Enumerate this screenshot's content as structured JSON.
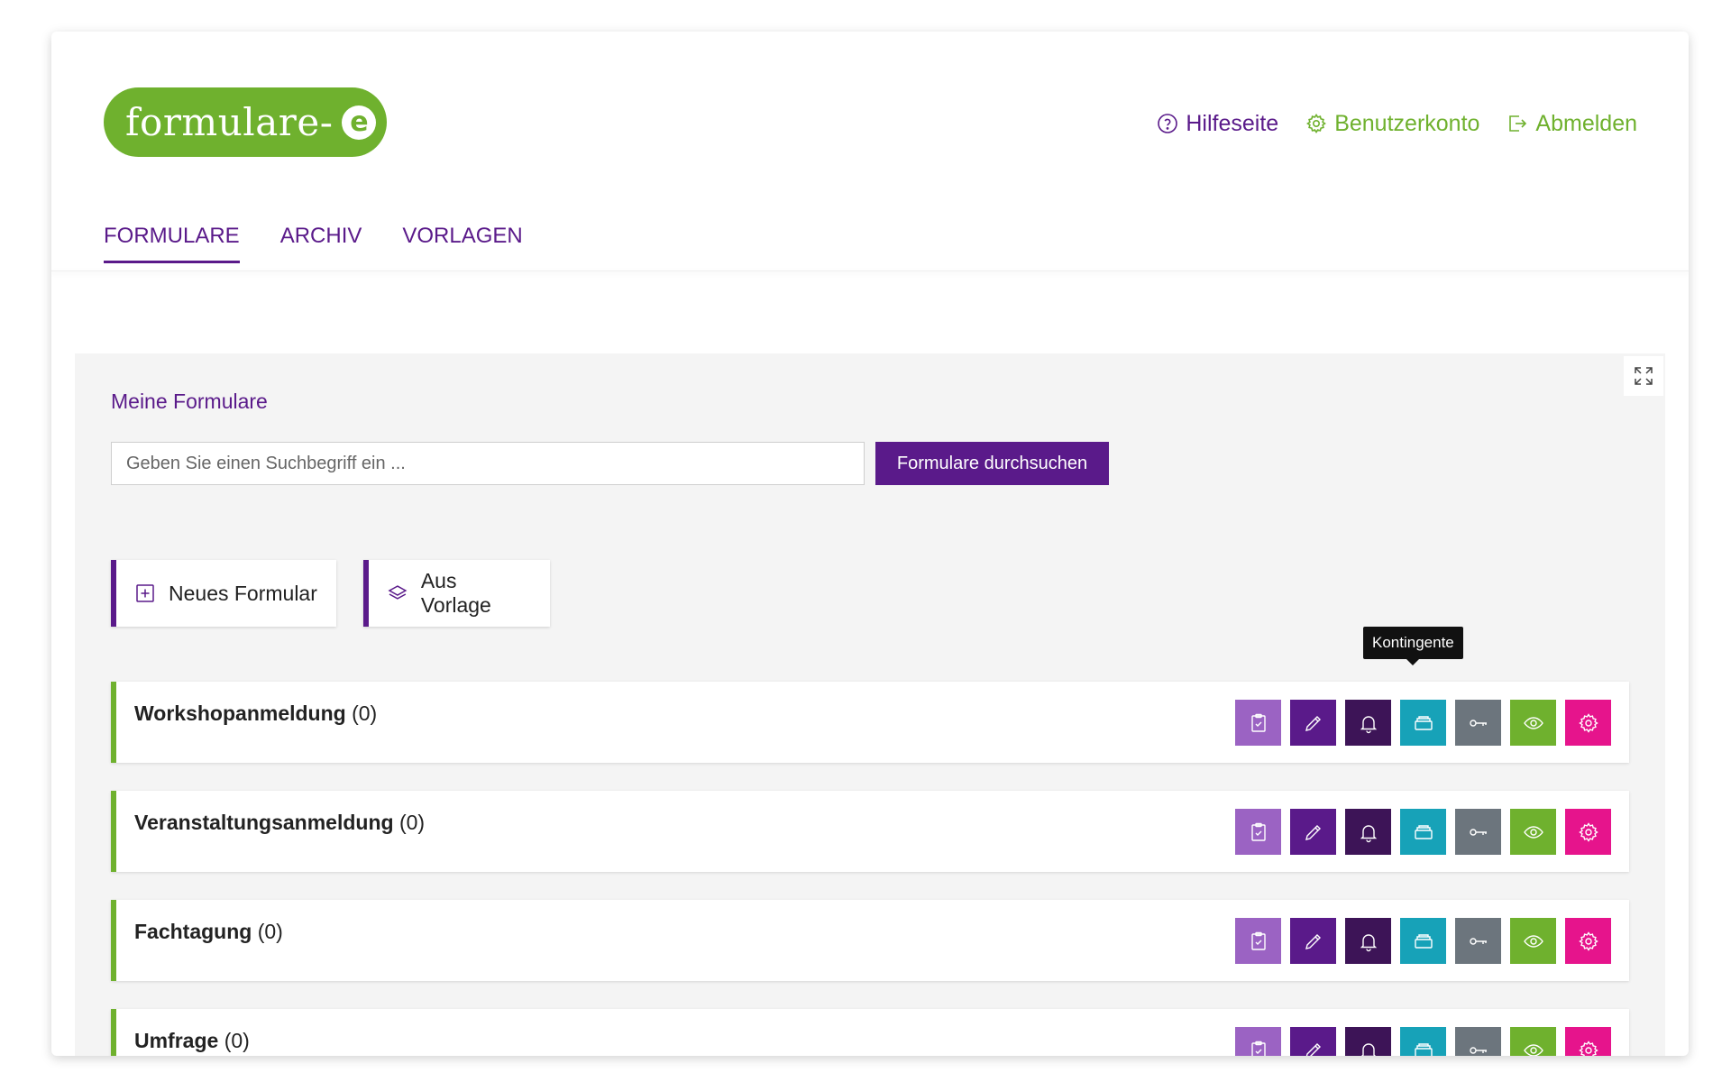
{
  "header": {
    "logo_text": "formulare-",
    "logo_badge": "e",
    "nav": {
      "help": "Hilfeseite",
      "account": "Benutzerkonto",
      "logout": "Abmelden"
    }
  },
  "tabs": [
    {
      "label": "FORMULARE",
      "active": true
    },
    {
      "label": "ARCHIV",
      "active": false
    },
    {
      "label": "VORLAGEN",
      "active": false
    }
  ],
  "main": {
    "title": "Meine Formulare",
    "search": {
      "placeholder": "Geben Sie einen Suchbegriff ein ...",
      "button": "Formulare durchsuchen"
    },
    "actions": {
      "new_form": "Neues Formular",
      "from_template": "Aus Vorlage"
    },
    "tooltip": "Kontingente",
    "forms": [
      {
        "name": "Workshopanmeldung",
        "count": "(0)"
      },
      {
        "name": "Veranstaltungsanmeldung",
        "count": "(0)"
      },
      {
        "name": "Fachtagung",
        "count": "(0)"
      },
      {
        "name": "Umfrage",
        "count": "(0)"
      }
    ],
    "row_icons": [
      "clipboard-check-icon",
      "pencil-icon",
      "bell-icon",
      "inbox-tray-icon",
      "key-icon",
      "eye-icon",
      "gear-icon"
    ]
  },
  "colors": {
    "brand_green": "#6fb12e",
    "brand_purple": "#5a1a8a",
    "icon_light_purple": "#9b63c3",
    "icon_dark_purple": "#3d1457",
    "icon_teal": "#17a2b8",
    "icon_gray": "#6c757d",
    "icon_pink": "#e6148c"
  }
}
